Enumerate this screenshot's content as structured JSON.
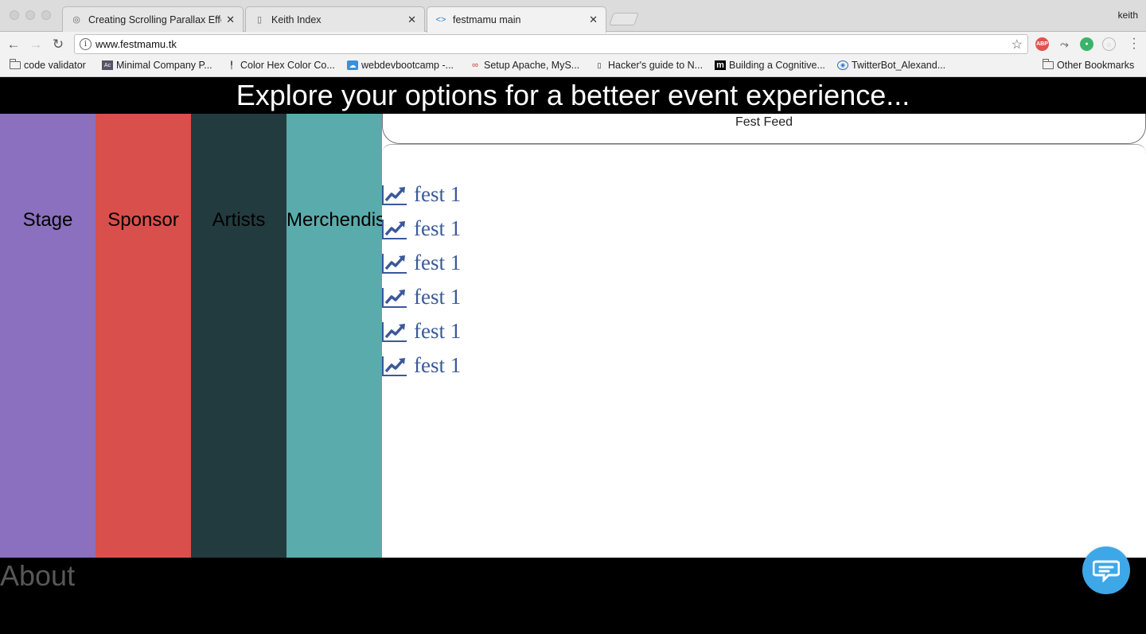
{
  "browser": {
    "tabs": [
      {
        "label": "Creating Scrolling Parallax Effe",
        "icon": "globe-icon"
      },
      {
        "label": "Keith Index",
        "icon": "page-icon"
      },
      {
        "label": "festmamu main",
        "icon": "code-icon"
      }
    ],
    "profile_name": "keith",
    "address": "www.festmamu.tk",
    "bookmarks": [
      {
        "label": "code validator",
        "icon": "folder-icon"
      },
      {
        "label": "Minimal Company P...",
        "icon": "site-icon"
      },
      {
        "label": "Color Hex Color Co...",
        "icon": "pin-icon"
      },
      {
        "label": "webdevbootcamp -...",
        "icon": "site-icon"
      },
      {
        "label": "Setup Apache, MyS...",
        "icon": "site-icon"
      },
      {
        "label": "Hacker's guide to N...",
        "icon": "page-icon"
      },
      {
        "label": "Building a Cognitive...",
        "icon": "m-icon"
      },
      {
        "label": "TwitterBot_Alexand...",
        "icon": "site-icon"
      },
      {
        "label": "Other Bookmarks",
        "icon": "folder-icon"
      }
    ],
    "extensions": [
      "adblock-icon",
      "extension-icon",
      "extension-icon",
      "extension-icon"
    ]
  },
  "page": {
    "hero_title": "Explore your options for a betteer event experience...",
    "panels": [
      {
        "label": "Stage",
        "color": "#8a70be"
      },
      {
        "label": "Sponsor",
        "color": "#d94f4b"
      },
      {
        "label": "Artists",
        "color": "#223b3f"
      },
      {
        "label": "Merchendise",
        "color": "#5aabab"
      }
    ],
    "feed": {
      "title": "Fest Feed",
      "items": [
        "fest 1",
        "fest 1",
        "fest 1",
        "fest 1",
        "fest 1",
        "fest 1"
      ],
      "item_icon": "trending-up-chart-icon",
      "link_color": "#3b5998"
    },
    "about_title": "About",
    "chat_button_color": "#3ea7e8"
  }
}
